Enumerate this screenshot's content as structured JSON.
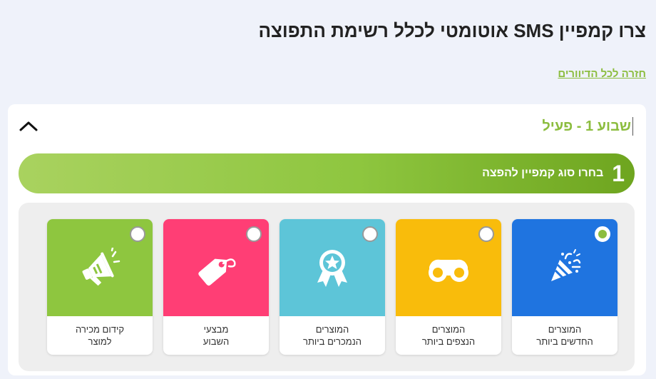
{
  "header": {
    "title": "צרו קמפיין SMS אוטומטי לכלל רשימת התפוצה",
    "back_link": "חזרה לכל הדיוורים"
  },
  "week": {
    "title": "שבוע 1 - פעיל"
  },
  "step": {
    "number": "1",
    "label": "בחרו סוג קמפיין להפצה"
  },
  "options": [
    {
      "label": "המוצרים\nהחדשים ביותר",
      "color": "#1f74e0",
      "icon": "party-popper-icon",
      "selected": true
    },
    {
      "label": "המוצרים\nהנצפים ביותר",
      "color": "#f9bc0b",
      "icon": "binoculars-icon",
      "selected": false
    },
    {
      "label": "המוצרים\nהנמכרים ביותר",
      "color": "#5dc5d8",
      "icon": "award-ribbon-icon",
      "selected": false
    },
    {
      "label": "מבצעי\nהשבוע",
      "color": "#ff3e75",
      "icon": "price-tag-icon",
      "selected": false
    },
    {
      "label": "קידום מכירה\nלמוצר",
      "color": "#8ec63f",
      "icon": "megaphone-icon",
      "selected": false
    }
  ]
}
